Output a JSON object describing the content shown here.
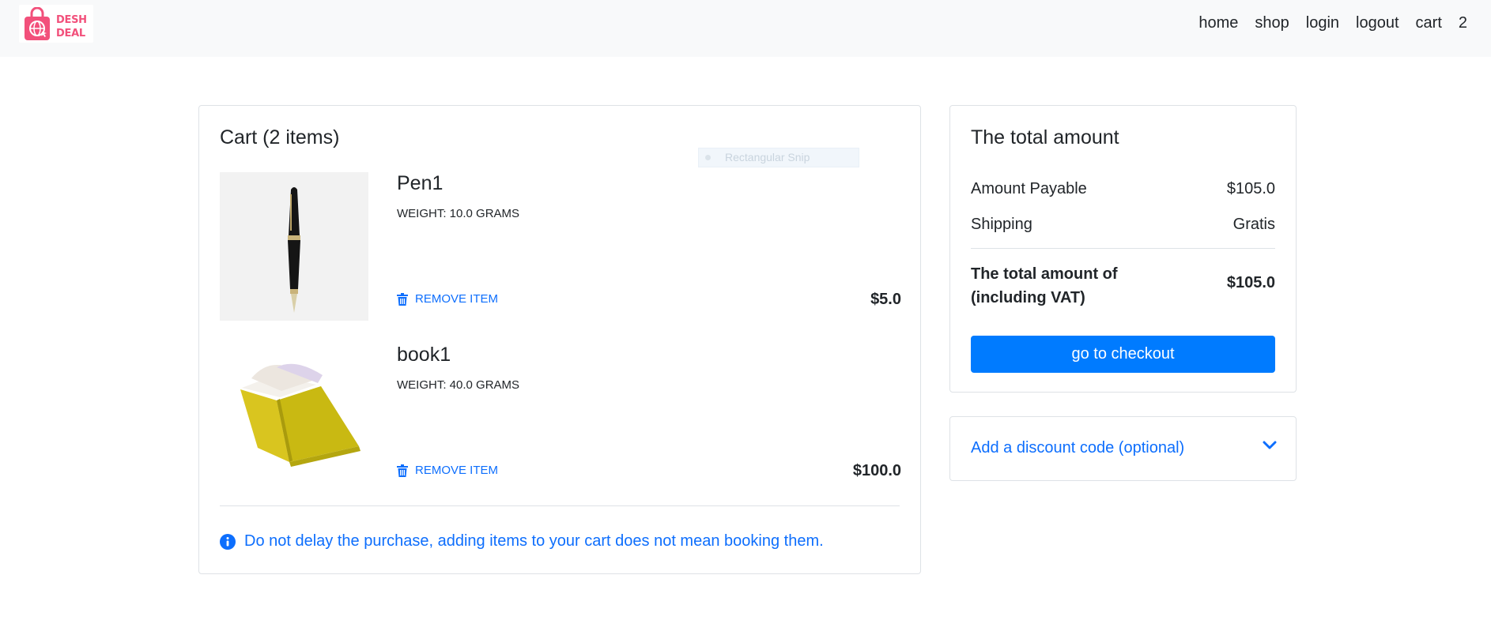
{
  "brand": {
    "logo_line1": "DESH",
    "logo_line2": "DEAL",
    "color": "#f2507b"
  },
  "nav": {
    "home": "home",
    "shop": "shop",
    "login": "login",
    "logout": "logout",
    "cart": "cart",
    "cart_count": "2"
  },
  "cart": {
    "title": "Cart (2 items)",
    "items": [
      {
        "name": "Pen1",
        "weight": "WEIGHT: 10.0 GRAMS",
        "remove_label": "REMOVE ITEM",
        "price": "$5.0",
        "image": "pen-image"
      },
      {
        "name": "book1",
        "weight": "WEIGHT: 40.0 GRAMS",
        "remove_label": "REMOVE ITEM",
        "price": "$100.0",
        "image": "yellow-book-image"
      }
    ],
    "notice": "Do not delay the purchase, adding items to your cart does not mean booking them.",
    "overlay": "Rectangular Snip"
  },
  "summary": {
    "title": "The total amount",
    "amount_payable_label": "Amount Payable",
    "amount_payable_value": "$105.0",
    "shipping_label": "Shipping",
    "shipping_value": "Gratis",
    "total_label": "The total amount of (including VAT)",
    "total_value": "$105.0",
    "checkout_label": "go to checkout"
  },
  "discount": {
    "label": "Add a discount code (optional)"
  },
  "colors": {
    "accent": "#0d6efd",
    "button": "#007bff",
    "border": "#dee2e6",
    "navbar_bg": "#f8f9fa"
  }
}
